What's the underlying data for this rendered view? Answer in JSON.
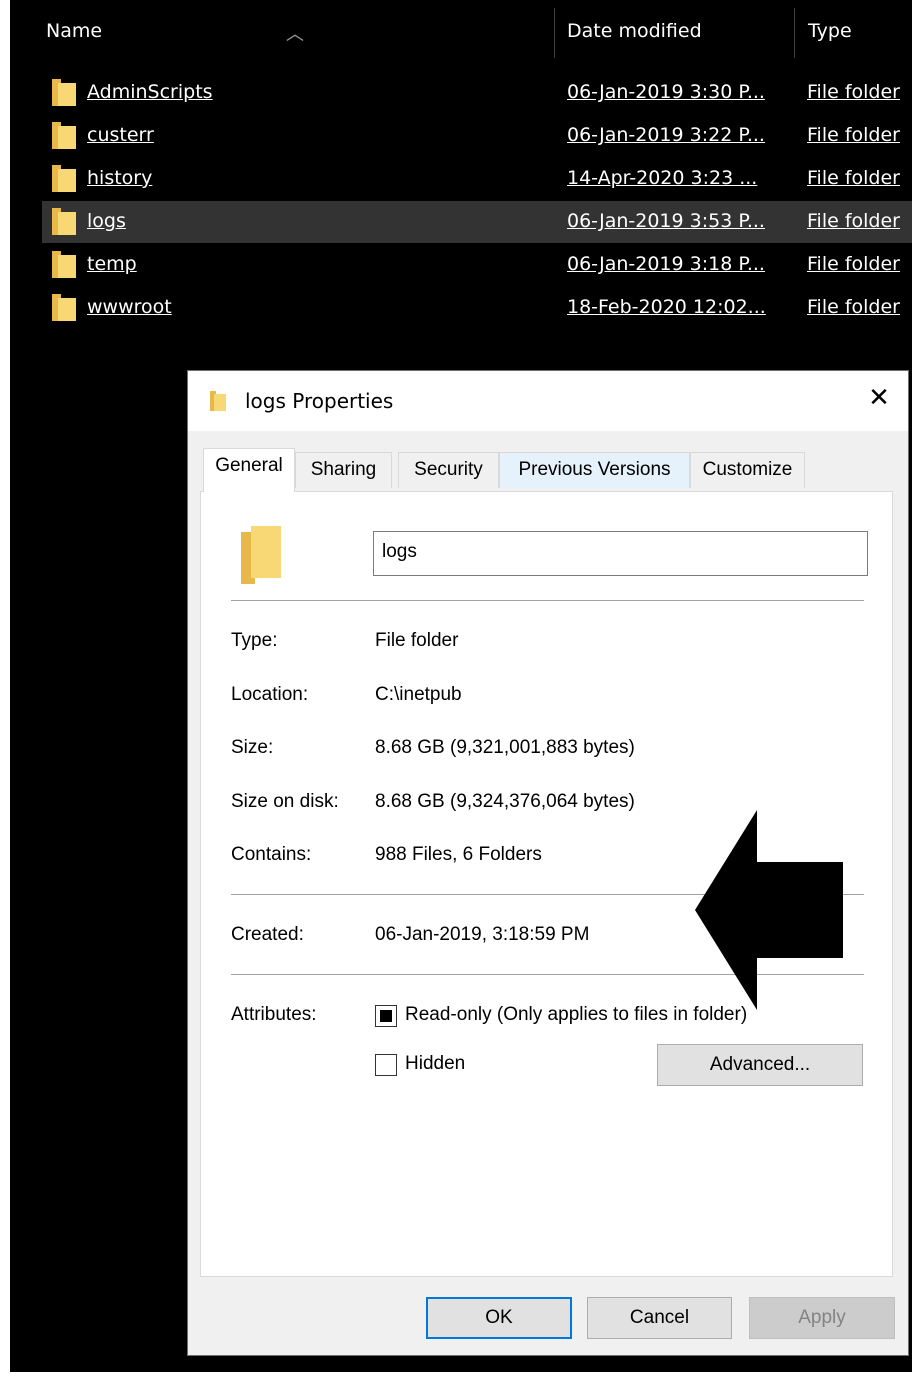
{
  "explorer": {
    "columns": {
      "name": "Name",
      "date": "Date modified",
      "type": "Type"
    },
    "rows": [
      {
        "name": "AdminScripts",
        "date": "06-Jan-2019 3:30 P...",
        "type": "File folder"
      },
      {
        "name": "custerr",
        "date": "06-Jan-2019 3:22 P...",
        "type": "File folder"
      },
      {
        "name": "history",
        "date": "14-Apr-2020 3:23 ...",
        "type": "File folder"
      },
      {
        "name": "logs",
        "date": "06-Jan-2019 3:53 P...",
        "type": "File folder"
      },
      {
        "name": "temp",
        "date": "06-Jan-2019 3:18 P...",
        "type": "File folder"
      },
      {
        "name": "wwwroot",
        "date": "18-Feb-2020 12:02...",
        "type": "File folder"
      }
    ],
    "selected_row": "logs"
  },
  "dialog": {
    "title": "logs Properties",
    "close_glyph": "✕",
    "tabs": [
      "General",
      "Sharing",
      "Security",
      "Previous Versions",
      "Customize"
    ],
    "active_tab": "General",
    "name_value": "logs",
    "props": {
      "type_label": "Type:",
      "type_value": "File folder",
      "location_label": "Location:",
      "location_value": "C:\\inetpub",
      "size_label": "Size:",
      "size_value": "8.68 GB (9,321,001,883 bytes)",
      "disk_label": "Size on disk:",
      "disk_value": "8.68 GB (9,324,376,064 bytes)",
      "contains_label": "Contains:",
      "contains_value": "988 Files, 6 Folders",
      "created_label": "Created:",
      "created_value": "06-Jan-2019, 3:18:59 PM"
    },
    "attributes": {
      "label": "Attributes:",
      "readonly_label": "Read-only (Only applies to files in folder)",
      "readonly_state": "indeterminate",
      "hidden_label": "Hidden",
      "hidden_checked": false,
      "advanced_label": "Advanced..."
    },
    "buttons": {
      "ok": "OK",
      "cancel": "Cancel",
      "apply": "Apply"
    }
  },
  "colors": {
    "explorer_bg": "#000000",
    "selected_row_bg": "#333333",
    "folder_yellow": "#f8d775",
    "dialog_bg": "#f0f0f0",
    "default_button_border": "#0078d7",
    "annotation_arrow": "#000000"
  },
  "icons": {
    "folder": "folder-icon",
    "close": "close-icon",
    "sort": "sort-up-icon",
    "arrow": "left-arrow-annotation"
  }
}
